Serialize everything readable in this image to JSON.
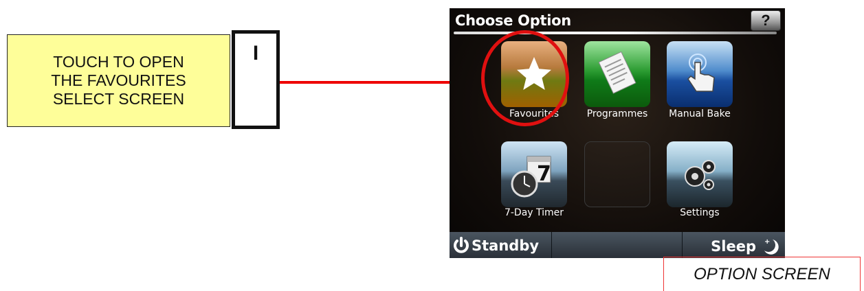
{
  "callout": {
    "lines": [
      "TOUCH TO OPEN",
      "THE FAVOURITES",
      "SELECT SCREEN"
    ],
    "step": "I"
  },
  "screen": {
    "title": "Choose Option",
    "help": "?",
    "tiles": [
      {
        "label": "Favourites",
        "icon": "star-icon"
      },
      {
        "label": "Programmes",
        "icon": "document-icon"
      },
      {
        "label": "Manual Bake",
        "icon": "hand-pointer-icon"
      },
      {
        "label": "7-Day Timer",
        "icon": "clock-calendar-icon",
        "calendar_number": "7"
      },
      {
        "label": "",
        "icon": ""
      },
      {
        "label": "Settings",
        "icon": "gears-icon"
      }
    ],
    "standby": "Standby",
    "sleep": "Sleep"
  },
  "option_screen_label": "OPTION SCREEN",
  "colors": {
    "callout_bg": "#fefe99",
    "arrow": "#e00000",
    "highlight": "#e01010"
  }
}
